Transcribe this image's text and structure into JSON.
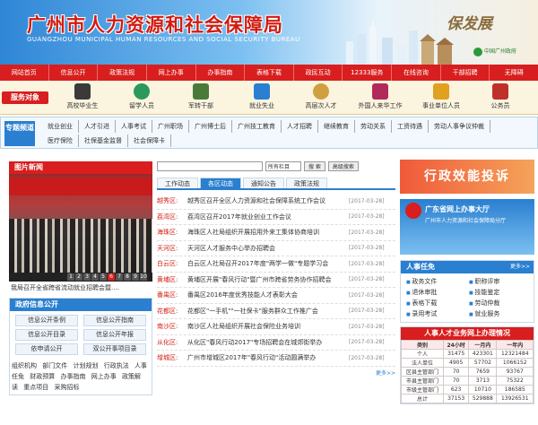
{
  "banner": {
    "title": "广州市人力资源和社会保障局",
    "subtitle": "GUANGZHOU MUNICIPAL HUMAN RESOURCES AND SOCIAL SECURITY BUREAU",
    "slogan": "保发展",
    "gov_logo_text": "中国广州政府"
  },
  "nav": [
    "网站首页",
    "信息公开",
    "政策法规",
    "网上办事",
    "办事指南",
    "表格下载",
    "政民互动",
    "12333服务",
    "在线咨询",
    "干部招聘",
    "无障碍"
  ],
  "services": {
    "label": "服务对象",
    "items": [
      "高校毕业生",
      "留学人员",
      "军转干部",
      "就业失业",
      "高层次人才",
      "外国人来华工作",
      "事业单位人员",
      "公务员"
    ]
  },
  "special": {
    "label": "专题频道",
    "row1": [
      "就业创业",
      "人才引进",
      "人事考试",
      "广州职场",
      "广州博士后",
      "广州技工教育",
      "人才招聘",
      "继续教育",
      "劳动关系",
      "工资待遇",
      "劳动人事争议仲裁"
    ],
    "row2": [
      "医疗保险",
      "社保基金监督",
      "社会保障卡"
    ]
  },
  "photo_news": {
    "head": "图片新闻",
    "caption": "我局召开全省跨省流动就业招聘会暨....",
    "pages": [
      "1",
      "2",
      "3",
      "4",
      "5",
      "6",
      "7",
      "8",
      "9",
      "10"
    ],
    "active_page": "6"
  },
  "gov_open": {
    "head": "政府信息公开",
    "buttons": [
      "信息公开条例",
      "信息公开指南",
      "信息公开目录",
      "信息公开年报",
      "依申请公开",
      "双公开事项目录"
    ],
    "links": [
      "组织机构",
      "部门文件",
      "计划规划",
      "行政执法",
      "人事任免",
      "财政预算",
      "办事指南",
      "网上办事",
      "政策解读",
      "重点项目",
      "采购招标"
    ]
  },
  "search": {
    "select": "所有栏目",
    "button1": "搜 索",
    "button2": "高级搜索"
  },
  "tabs": [
    "工作动态",
    "各区动态",
    "通知公告",
    "政策法规"
  ],
  "active_tab": "各区动态",
  "news": [
    {
      "district": "越秀区:",
      "title": "越秀区召开全区人力资源和社会保障系统工作会议",
      "date": "[2017-03-28]"
    },
    {
      "district": "荔湾区:",
      "title": "荔湾区召开2017年就业创业工作会议",
      "date": "[2017-03-28]"
    },
    {
      "district": "海珠区:",
      "title": "海珠区人社局组织开展招用外来工集体协商培训",
      "date": "[2017-03-28]"
    },
    {
      "district": "天河区:",
      "title": "天河区人才服务中心举办招聘会",
      "date": "[2017-03-28]"
    },
    {
      "district": "白云区:",
      "title": "白云区人社局召开2017年度\"两学一做\"专题学习会",
      "date": "[2017-03-28]"
    },
    {
      "district": "黄埔区:",
      "title": "黄埔区开展\"春风行动\"暨广州市跨省劳务协作招聘会",
      "date": "[2017-03-28]"
    },
    {
      "district": "番禺区:",
      "title": "番禺区2016年度优秀技能人才表彰大会",
      "date": "[2017-03-28]"
    },
    {
      "district": "花都区:",
      "title": "花都区\"一手机\"\"一社保卡\"服务群众工作推广会",
      "date": "[2017-03-28]"
    },
    {
      "district": "南沙区:",
      "title": "南沙区人社局组织开展社会保险业务培训",
      "date": "[2017-03-28]"
    },
    {
      "district": "从化区:",
      "title": "从化区\"春风行动2017\"专场招聘会在城郊街举办",
      "date": "[2017-03-28]"
    },
    {
      "district": "增城区:",
      "title": "广州市增城区2017年\"春风行动\"活动圆满举办",
      "date": "[2017-03-28]"
    }
  ],
  "news_more": "更多>>",
  "complaint": "行政效能投诉",
  "hall": {
    "title": "广东省网上办事大厅",
    "subtitle": "广州市人力资源和社会保障局分厅"
  },
  "tasks": {
    "head": "人事任免",
    "more": "更多>>",
    "items": [
      "政务文件",
      "职称评审",
      "退休审批",
      "技能鉴定",
      "表格下载",
      "劳动仲裁",
      "录用考试",
      "就业服务"
    ]
  },
  "stats": {
    "head": "人事人才业务网上办理情况",
    "columns": [
      "类别",
      "24小时",
      "一月内",
      "一年内"
    ],
    "rows": [
      [
        "个人",
        "31475",
        "423301",
        "12321484"
      ],
      [
        "法人单位",
        "4905",
        "57702",
        "1066152"
      ],
      [
        "区县主管部门",
        "70",
        "7659",
        "93767"
      ],
      [
        "市县主管部门",
        "70",
        "3713",
        "75322"
      ],
      [
        "市级主管部门",
        "623",
        "10710",
        "186585"
      ],
      [
        "总计",
        "37153",
        "529888",
        "13926531"
      ]
    ]
  },
  "colors": {
    "brand_red": "#d81e1e",
    "brand_blue": "#2a7fd0"
  }
}
